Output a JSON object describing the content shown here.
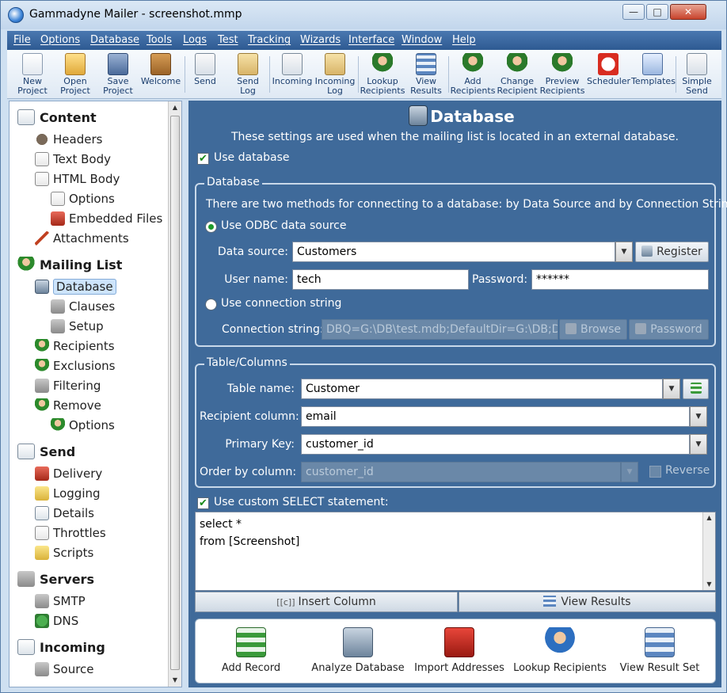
{
  "window": {
    "title": "Gammadyne Mailer - screenshot.mmp"
  },
  "menu": [
    "File",
    "Options",
    "Database",
    "Tools",
    "Logs",
    "Test",
    "Tracking",
    "Wizards",
    "Interface",
    "Window",
    "Help"
  ],
  "toolbar": [
    {
      "label1": "New",
      "label2": "Project",
      "icon": "new-project-icon"
    },
    {
      "label1": "Open",
      "label2": "Project",
      "icon": "open-project-icon"
    },
    {
      "label1": "Save",
      "label2": "Project",
      "icon": "save-project-icon"
    },
    {
      "label1": "Welcome",
      "label2": "",
      "icon": "welcome-icon"
    },
    {
      "label1": "Send",
      "label2": "",
      "icon": "send-icon"
    },
    {
      "label1": "Send",
      "label2": "Log",
      "icon": "send-log-icon"
    },
    {
      "label1": "Incoming",
      "label2": "",
      "icon": "incoming-icon"
    },
    {
      "label1": "Incoming",
      "label2": "Log",
      "icon": "incoming-log-icon"
    },
    {
      "label1": "Lookup",
      "label2": "Recipients",
      "icon": "lookup-recipients-icon"
    },
    {
      "label1": "View",
      "label2": "Results",
      "icon": "view-results-icon"
    },
    {
      "label1": "Add",
      "label2": "Recipients",
      "icon": "add-recipients-icon"
    },
    {
      "label1": "Change",
      "label2": "Recipient",
      "icon": "change-recipient-icon"
    },
    {
      "label1": "Preview",
      "label2": "Recipients",
      "icon": "preview-recipients-icon"
    },
    {
      "label1": "Scheduler",
      "label2": "",
      "icon": "scheduler-icon"
    },
    {
      "label1": "Templates",
      "label2": "",
      "icon": "templates-icon"
    },
    {
      "label1": "Simple",
      "label2": "Send",
      "icon": "simple-send-icon"
    }
  ],
  "sidebar": {
    "groups": {
      "content": "Content",
      "mailing_list": "Mailing List",
      "send": "Send",
      "servers": "Servers",
      "incoming": "Incoming"
    },
    "items": {
      "headers": "Headers",
      "text_body": "Text Body",
      "html_body": "HTML Body",
      "html_options": "Options",
      "embedded_files": "Embedded Files",
      "attachments": "Attachments",
      "database": "Database",
      "clauses": "Clauses",
      "setup": "Setup",
      "recipients": "Recipients",
      "exclusions": "Exclusions",
      "filtering": "Filtering",
      "remove": "Remove",
      "remove_options": "Options",
      "delivery": "Delivery",
      "logging": "Logging",
      "details": "Details",
      "throttles": "Throttles",
      "scripts": "Scripts",
      "smtp": "SMTP",
      "dns": "DNS",
      "source": "Source"
    }
  },
  "page": {
    "title": "Database",
    "subtitle": "These settings are used when the mailing list is located in an external database.",
    "use_database_label": "Use database",
    "use_database_checked": true
  },
  "database_group": {
    "title": "Database",
    "description": "There are two methods for connecting to a database: by Data Source and by Connection String.",
    "odbc_label": "Use ODBC data source",
    "data_source_label": "Data source:",
    "data_source_value": "Customers",
    "register_label": "Register",
    "username_label": "User name:",
    "username_value": "tech",
    "password_label": "Password:",
    "password_value": "******",
    "connstr_radio_label": "Use connection string",
    "connstr_label": "Connection string:",
    "connstr_value": "DBQ=G:\\DB\\test.mdb;DefaultDir=G:\\DB;Dri",
    "browse_label": "Browse",
    "connstr_password_label": "Password"
  },
  "table_group": {
    "title": "Table/Columns",
    "table_name_label": "Table name:",
    "table_name_value": "Customer",
    "recipient_col_label": "Recipient column:",
    "recipient_col_value": "email",
    "primary_key_label": "Primary Key:",
    "primary_key_value": "customer_id",
    "order_by_label": "Order by column:",
    "order_by_value": "customer_id",
    "reverse_label": "Reverse"
  },
  "select": {
    "label": "Use custom SELECT statement:",
    "checked": true,
    "line1": "select *",
    "line2": "from [Screenshot]",
    "insert_column_label": "Insert Column",
    "view_results_label": "View Results"
  },
  "actions": [
    {
      "label": "Add Record",
      "icon": "add-record-icon"
    },
    {
      "label": "Analyze Database",
      "icon": "analyze-database-icon"
    },
    {
      "label": "Import Addresses",
      "icon": "import-addresses-icon"
    },
    {
      "label": "Lookup Recipients",
      "icon": "lookup-recipients-icon"
    },
    {
      "label": "View Result Set",
      "icon": "view-result-set-icon"
    }
  ]
}
